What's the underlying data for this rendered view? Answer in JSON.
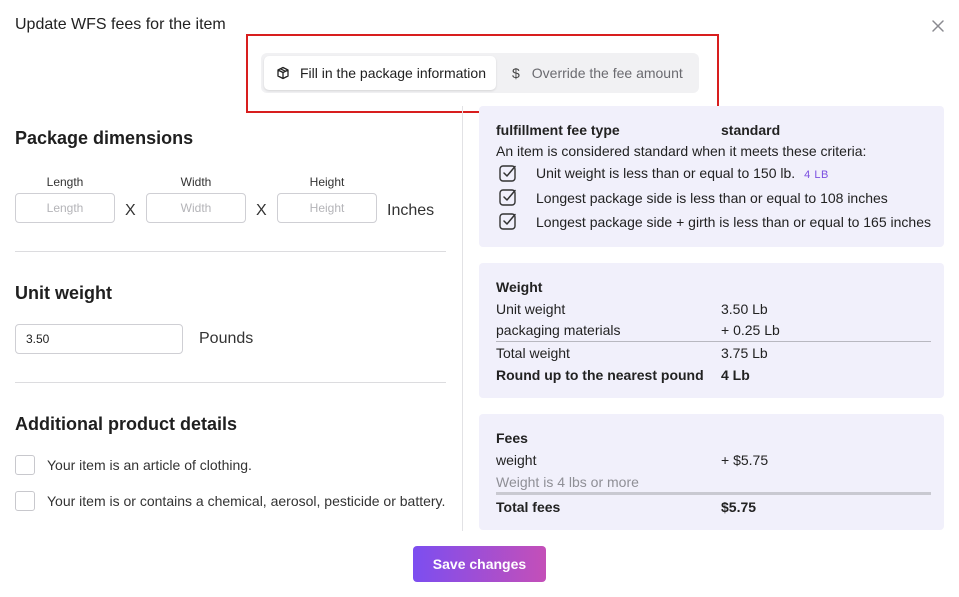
{
  "dialog": {
    "title": "Update WFS fees for the item",
    "close_icon": "close-icon"
  },
  "mode_toggle": {
    "options": [
      {
        "label": "Fill in the package information",
        "icon": "package-icon",
        "active": true
      },
      {
        "label": "Override the fee amount",
        "icon": "dollar-icon",
        "active": false
      }
    ]
  },
  "package_dimensions": {
    "title": "Package dimensions",
    "fields": [
      {
        "label": "Length",
        "placeholder": "Length",
        "value": ""
      },
      {
        "label": "Width",
        "placeholder": "Width",
        "value": ""
      },
      {
        "label": "Height",
        "placeholder": "Height",
        "value": ""
      }
    ],
    "separator": "X",
    "unit": "Inches"
  },
  "unit_weight": {
    "title": "Unit weight",
    "value": "3.50",
    "unit": "Pounds"
  },
  "additional_details": {
    "title": "Additional product details",
    "options": [
      {
        "label": "Your item is an article of clothing.",
        "checked": false
      },
      {
        "label": "Your item is or contains a chemical, aerosol, pesticide or battery.",
        "checked": false
      }
    ]
  },
  "fee_type_card": {
    "label": "fulfillment fee type",
    "value": "standard",
    "description": "An item is considered standard when it meets these criteria:",
    "criteria": [
      {
        "text": "Unit weight is less than or equal to 150 lb.",
        "badge": "4 LB",
        "icon": "checkbox-checked-icon"
      },
      {
        "text": "Longest package side is less than or equal to 108 inches",
        "badge": "",
        "icon": "checkbox-checked-icon"
      },
      {
        "text": "Longest package side + girth is less than or equal to 165 inches",
        "badge": "",
        "icon": "checkbox-checked-icon"
      }
    ]
  },
  "weight_card": {
    "title": "Weight",
    "rows": [
      {
        "label": "Unit weight",
        "value": "3.50 Lb"
      },
      {
        "label": "packaging materials",
        "value": "+ 0.25 Lb"
      },
      {
        "label": "Total weight",
        "value": "3.75 Lb"
      },
      {
        "label": "Round up to the nearest pound",
        "value": "4 Lb"
      }
    ]
  },
  "fees_card": {
    "title": "Fees",
    "rows": [
      {
        "label": "weight",
        "value": "+ $5.75"
      },
      {
        "label": "Weight is 4 lbs or more",
        "value": ""
      }
    ],
    "total_label": "Total fees",
    "total_value": "$5.75"
  },
  "footer": {
    "save_label": "Save changes"
  },
  "colors": {
    "accent_start": "#7c4ef0",
    "accent_end": "#c44fb8",
    "card_bg": "#f1f0fb",
    "highlight_border": "#d81e1e",
    "badge": "#7b4fe0"
  }
}
